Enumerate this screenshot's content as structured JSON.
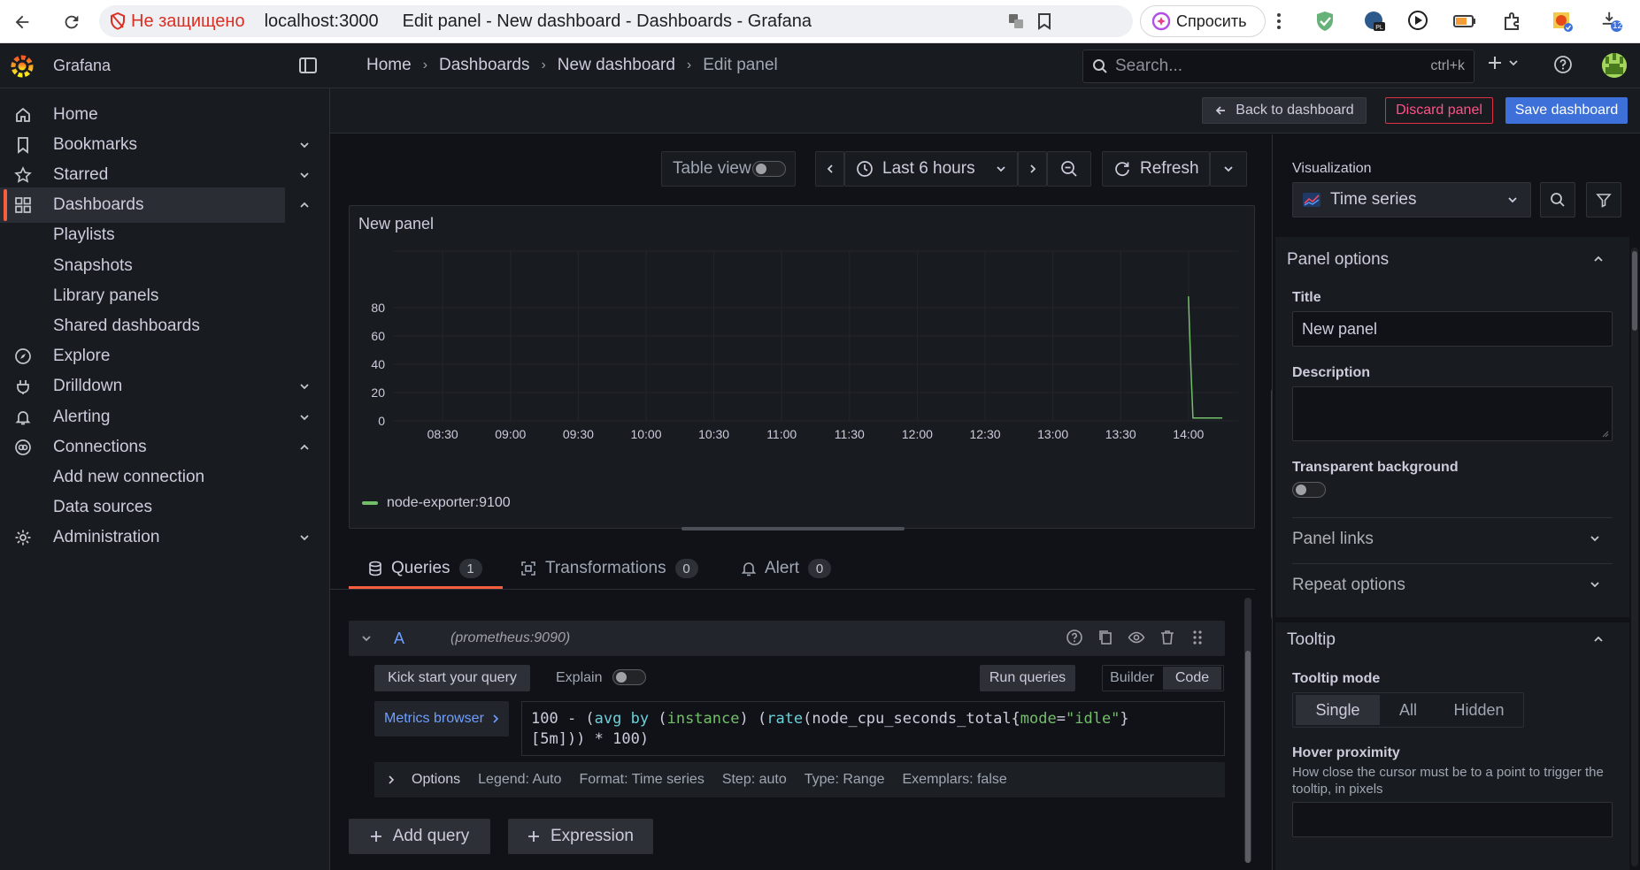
{
  "browser": {
    "insecure_label": "Не защищено",
    "url": "localhost:3000",
    "page_title": "Edit panel - New dashboard - Dashboards - Grafana",
    "ask_label": "Спросить",
    "ext_badge_count": "12"
  },
  "app": {
    "brand": "Grafana",
    "breadcrumb": [
      "Home",
      "Dashboards",
      "New dashboard",
      "Edit panel"
    ],
    "search_placeholder": "Search...",
    "search_shortcut": "ctrl+k"
  },
  "sidebar": {
    "items": [
      {
        "label": "Home",
        "icon": "home-icon"
      },
      {
        "label": "Bookmarks",
        "icon": "bookmark-icon",
        "expandable": true
      },
      {
        "label": "Starred",
        "icon": "star-icon",
        "expandable": true
      },
      {
        "label": "Dashboards",
        "icon": "apps-icon",
        "expanded": true,
        "active": true
      },
      {
        "label": "Playlists",
        "sub": true
      },
      {
        "label": "Snapshots",
        "sub": true
      },
      {
        "label": "Library panels",
        "sub": true
      },
      {
        "label": "Shared dashboards",
        "sub": true
      },
      {
        "label": "Explore",
        "icon": "compass-icon"
      },
      {
        "label": "Drilldown",
        "icon": "drilldown-icon",
        "expandable": true
      },
      {
        "label": "Alerting",
        "icon": "bell-icon",
        "expandable": true
      },
      {
        "label": "Connections",
        "icon": "link-icon",
        "expanded": true
      },
      {
        "label": "Add new connection",
        "sub": true
      },
      {
        "label": "Data sources",
        "sub": true
      },
      {
        "label": "Administration",
        "icon": "cog-icon",
        "expandable": true
      }
    ]
  },
  "toolbar": {
    "back_label": "Back to dashboard",
    "discard_label": "Discard panel",
    "save_label": "Save dashboard"
  },
  "controls": {
    "table_view_label": "Table view",
    "time_range": "Last 6 hours",
    "refresh_label": "Refresh"
  },
  "panel": {
    "title": "New panel"
  },
  "chart_data": {
    "type": "line",
    "title": "New panel",
    "x": [
      "08:30",
      "09:00",
      "09:30",
      "10:00",
      "10:30",
      "11:00",
      "11:30",
      "12:00",
      "12:30",
      "13:00",
      "13:30",
      "14:00"
    ],
    "y_ticks": [
      0,
      20,
      40,
      60,
      80
    ],
    "ylim": [
      0,
      100
    ],
    "series": [
      {
        "name": "node-exporter:9100",
        "color": "#73bf69",
        "points": [
          [
            "14:00",
            88
          ],
          [
            "14:01",
            40
          ],
          [
            "14:02",
            2
          ],
          [
            "14:15",
            2
          ]
        ]
      }
    ],
    "legend": "bottom-left",
    "grid": true
  },
  "query_tabs": [
    {
      "label": "Queries",
      "count": "1",
      "icon": "database-icon"
    },
    {
      "label": "Transformations",
      "count": "0",
      "icon": "transform-icon"
    },
    {
      "label": "Alert",
      "count": "0",
      "icon": "bell-icon"
    }
  ],
  "query": {
    "ref_id": "A",
    "datasource": "(prometheus:9090)",
    "kick_start_label": "Kick start your query",
    "explain_label": "Explain",
    "run_label": "Run queries",
    "mode_builder": "Builder",
    "mode_code": "Code",
    "metrics_browser": "Metrics browser",
    "expr_line1": "100 - (avg by (instance) (rate(node_cpu_seconds_total{mode=\"idle\"}",
    "expr_line2": "[5m])) * 100)",
    "options_title": "Options",
    "options": [
      "Legend: Auto",
      "Format: Time series",
      "Step: auto",
      "Type: Range",
      "Exemplars: false"
    ],
    "add_query_label": "Add query",
    "expression_label": "Expression"
  },
  "options_pane": {
    "visualization_label": "Visualization",
    "visualization_value": "Time series",
    "panel_options_header": "Panel options",
    "title_label": "Title",
    "title_value": "New panel",
    "description_label": "Description",
    "transparent_label": "Transparent background",
    "panel_links_label": "Panel links",
    "repeat_options_label": "Repeat options",
    "tooltip_header": "Tooltip",
    "tooltip_mode_label": "Tooltip mode",
    "tooltip_modes": [
      "Single",
      "All",
      "Hidden"
    ],
    "hover_proximity_label": "Hover proximity",
    "hover_proximity_desc": "How close the cursor must be to a point to trigger the tooltip, in pixels"
  }
}
